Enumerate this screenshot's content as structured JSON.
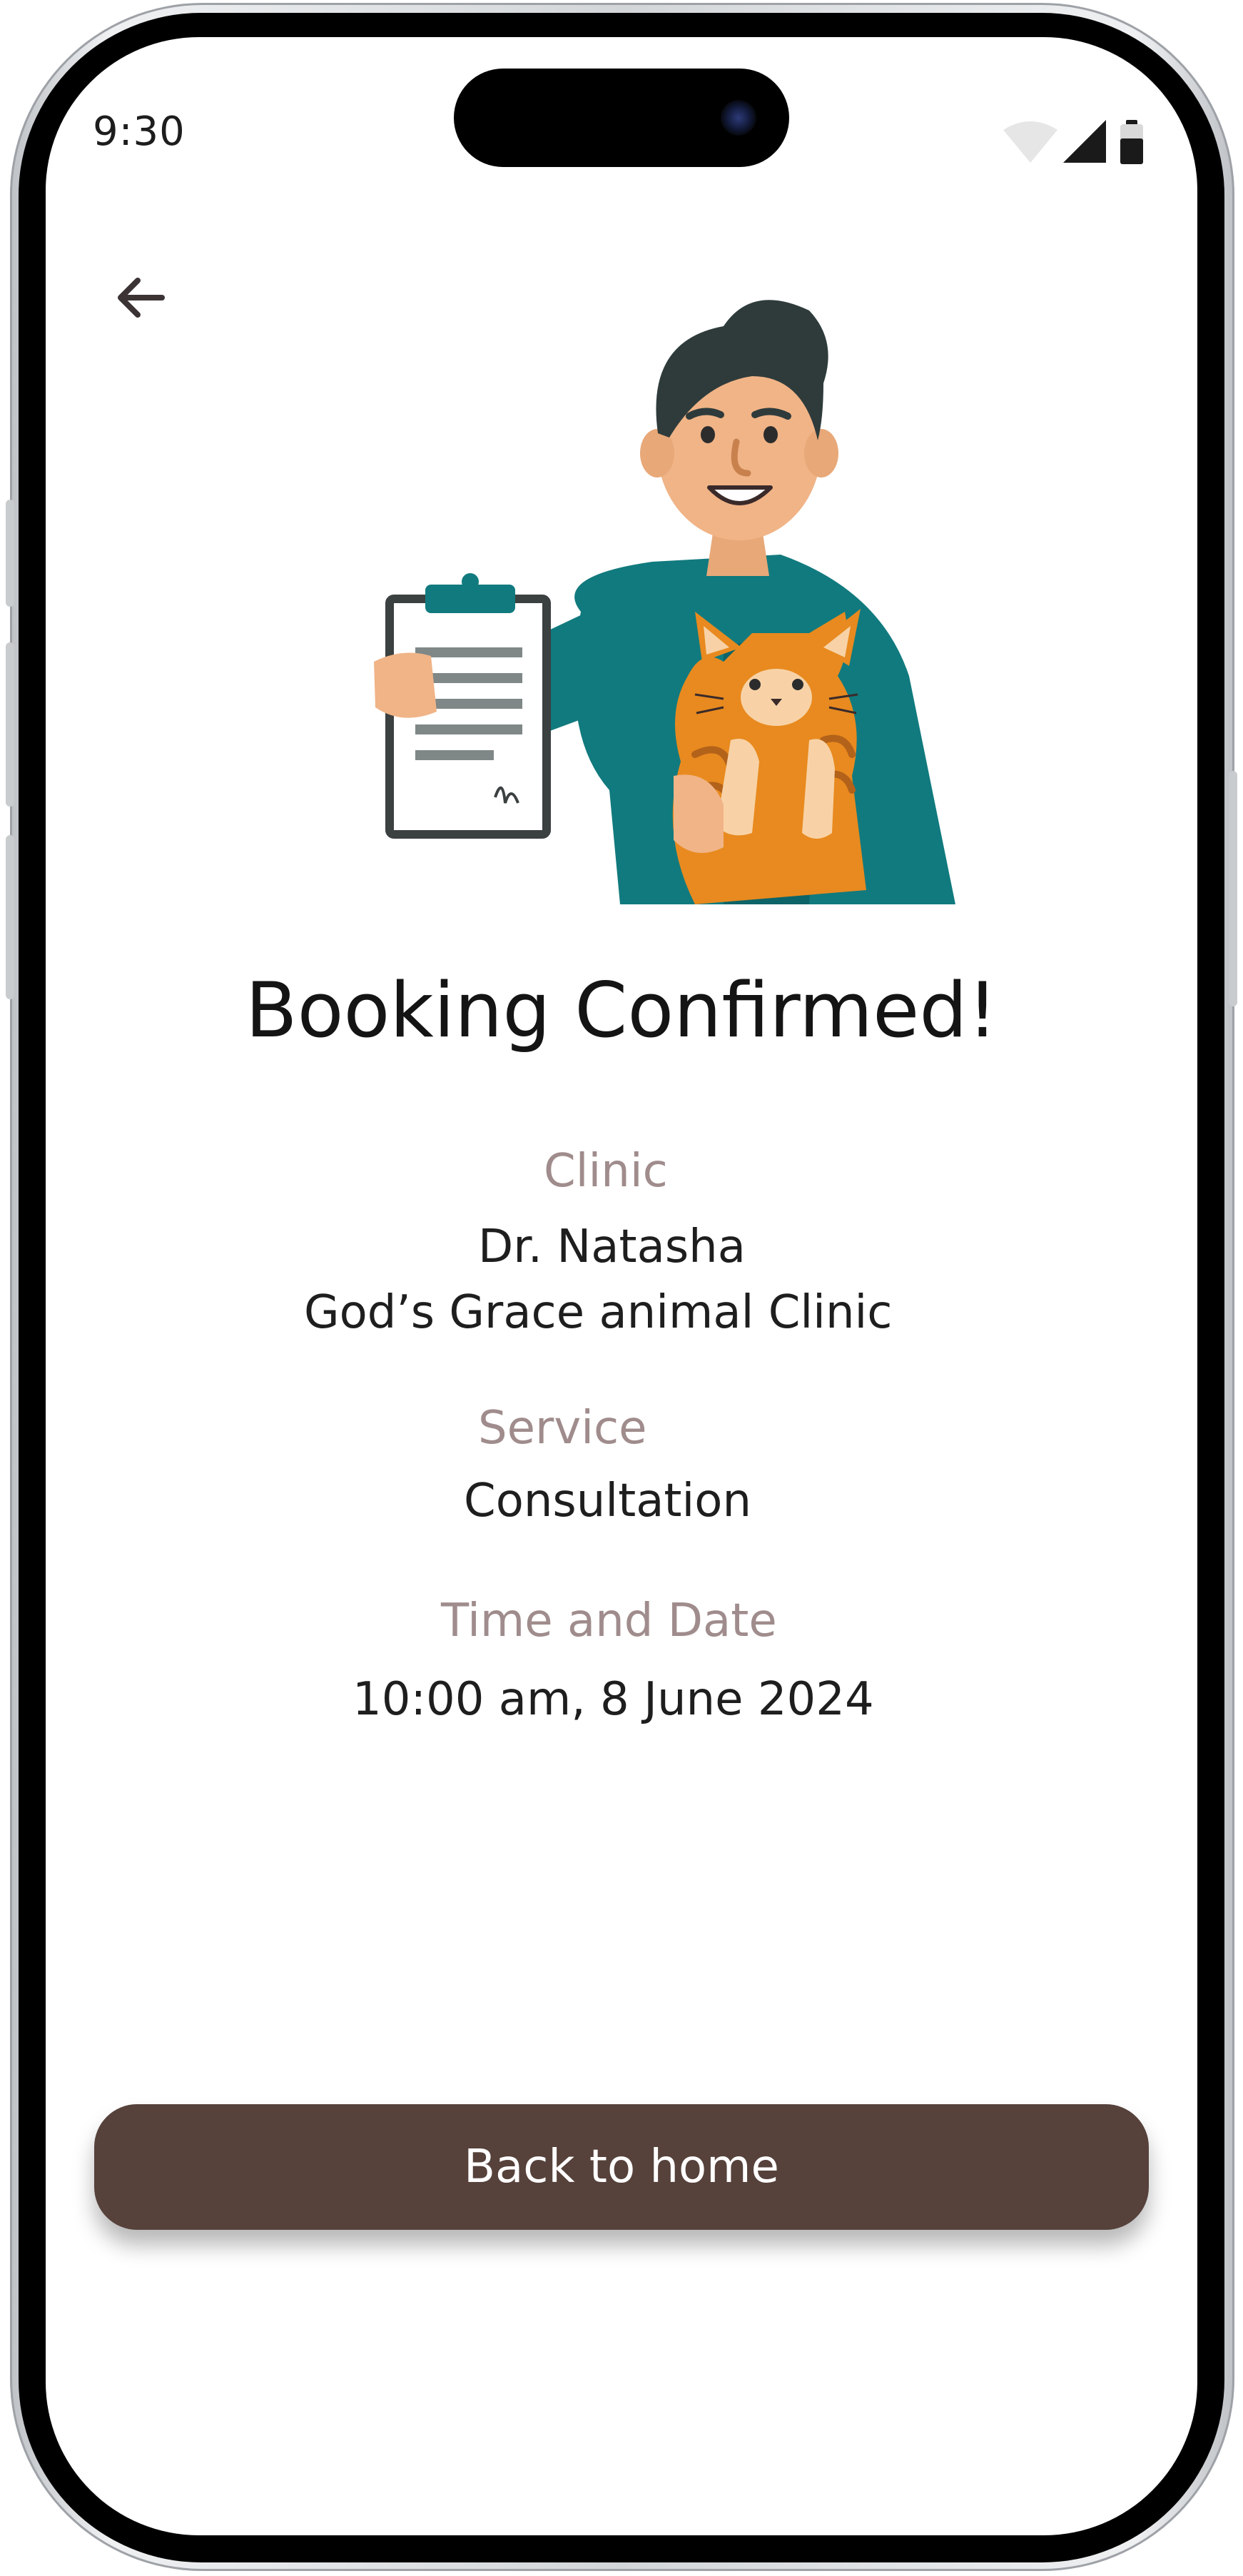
{
  "status_bar": {
    "time": "9:30"
  },
  "navigation": {
    "back_icon": "arrow-left-icon"
  },
  "illustration": {
    "subject": "person-holding-clipboard-and-cat"
  },
  "confirmation": {
    "title": "Booking Confirmed!",
    "clinic": {
      "label": "Clinic",
      "doctor": "Dr. Natasha",
      "name": "God’s Grace animal Clinic"
    },
    "service": {
      "label": "Service",
      "value": "Consultation"
    },
    "time_and_date": {
      "label": "Time and Date",
      "value": "10:00 am, 8 June 2024"
    }
  },
  "actions": {
    "home_button_label": "Back to home"
  },
  "colors": {
    "primary_button": "#56413b",
    "label_text": "#a08c8c",
    "body_text": "#1e1e1e",
    "teal_shirt": "#117a7e",
    "cat_orange": "#e88a1f"
  }
}
